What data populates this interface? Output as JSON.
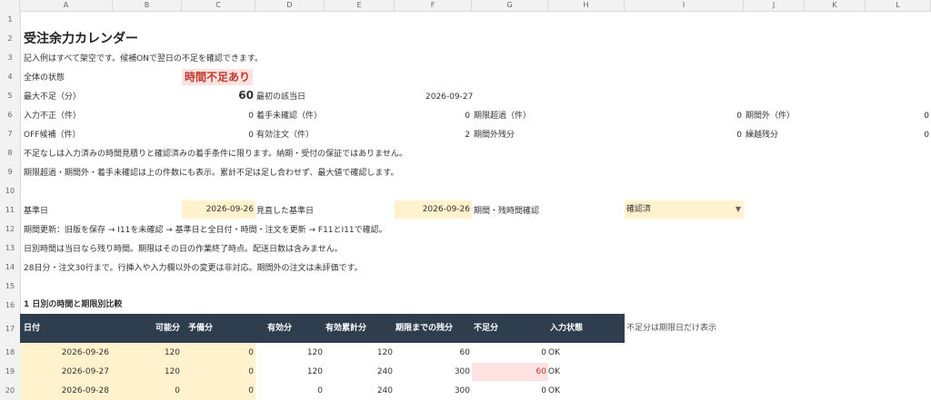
{
  "columns": [
    "A",
    "B",
    "C",
    "D",
    "E",
    "F",
    "G",
    "H",
    "I",
    "J",
    "K",
    "L"
  ],
  "rows": [
    "1",
    "2",
    "3",
    "4",
    "5",
    "6",
    "7",
    "8",
    "9",
    "10",
    "11",
    "12",
    "13",
    "14",
    "15",
    "16",
    "17",
    "18",
    "19",
    "20"
  ],
  "title": "受注余力カレンダー",
  "note_r3": "記入例はすべて架空です。候補ONで翌日の不足を確認できます。",
  "overall": {
    "label": "全体の状態",
    "value": "時間不足あり"
  },
  "max_short": {
    "label": "最大不足（分）",
    "value": "60"
  },
  "first_day": {
    "label": "最初の該当日",
    "value": "2026-09-27"
  },
  "r6": {
    "a_label": "入力不正（件）",
    "a_val": "0",
    "b_label": "着手未確認（件）",
    "b_val": "0",
    "c_label": "期限超過（件）",
    "c_val": "0",
    "d_label": "期間外（件）",
    "d_val": "0"
  },
  "r7": {
    "a_label": "OFF候補（件）",
    "a_val": "0",
    "b_label": "有効注文（件）",
    "b_val": "2",
    "c_label": "期間外残分",
    "c_val": "0",
    "d_label": "繰越残分",
    "d_val": "0"
  },
  "note_r8": "不足なしは入力済みの時間見積りと確認済みの着手条件に限ります。納期・受付の保証ではありません。",
  "note_r9": "期限超過・期間外・着手未確認は上の件数にも表示。累計不足は足し合わせず、最大値で確認します。",
  "base_date": {
    "label": "基準日",
    "value": "2026-09-26"
  },
  "reviewed_date": {
    "label": "見直した基準日",
    "value": "2026-09-26"
  },
  "period_check": {
    "label": "期間・残時間確認",
    "value": "確認済"
  },
  "note_r12": "期間更新：旧版を保存 → I11を未確認 → 基準日と全日付・時間・注文を更新 → F11とI11で確認。",
  "note_r13": "日別時間は当日なら残り時間。期限はその日の作業終了時点。配送日数は含みません。",
  "note_r14": "28日分・注文30行まで。行挿入や入力欄以外の変更は非対応。期間外の注文は未評価です。",
  "section1": "1  日別の時間と期限別比較",
  "table": {
    "headers": [
      "日付",
      "可能分",
      "予備分",
      "有効分",
      "有効累計分",
      "期限までの残分",
      "不足分",
      "入力状態"
    ],
    "side_note": "不足分は期限日だけ表示",
    "rows": [
      [
        "2026-09-26",
        "120",
        "0",
        "120",
        "120",
        "60",
        "0",
        "OK"
      ],
      [
        "2026-09-27",
        "120",
        "0",
        "120",
        "240",
        "300",
        "60",
        "OK"
      ],
      [
        "2026-09-28",
        "0",
        "0",
        "0",
        "240",
        "300",
        "0",
        "OK"
      ]
    ]
  }
}
